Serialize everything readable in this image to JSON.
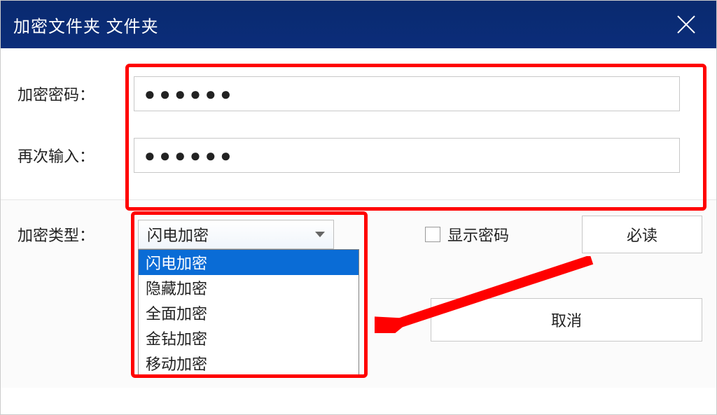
{
  "title": "加密文件夹 文件夹",
  "labels": {
    "password": "加密密码：",
    "confirm": "再次输入：",
    "type": "加密类型："
  },
  "inputs": {
    "password_mask": "●●●●●●",
    "confirm_mask": "●●●●●●"
  },
  "select": {
    "value": "闪电加密",
    "options": [
      "闪电加密",
      "隐藏加密",
      "全面加密",
      "金钻加密",
      "移动加密"
    ],
    "selected_index": 0
  },
  "checkbox": {
    "label": "显示密码",
    "checked": false
  },
  "buttons": {
    "must_read": "必读",
    "cancel": "取消"
  },
  "annotations": {
    "red_color": "#ff0000",
    "arrow_description": "red arrow pointing from right side to dropdown list"
  }
}
